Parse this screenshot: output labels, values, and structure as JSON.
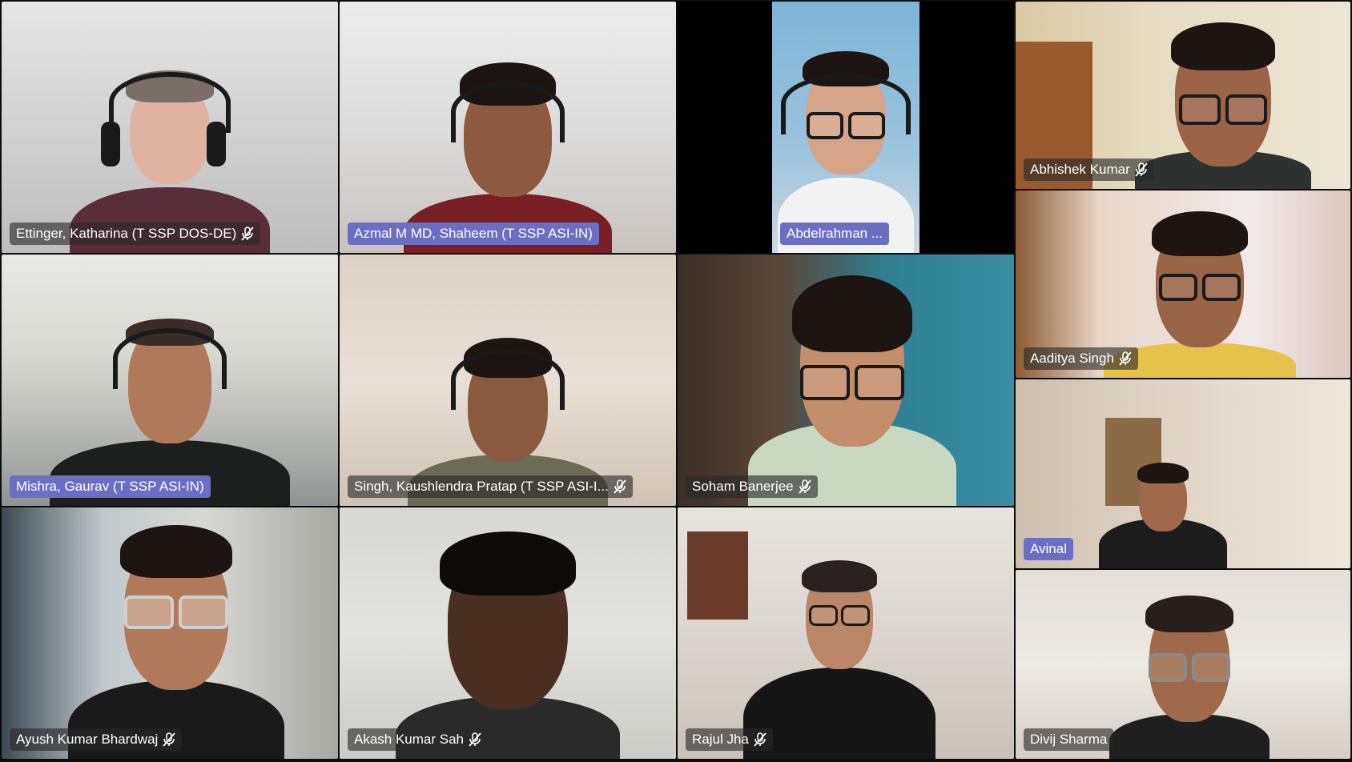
{
  "participants": [
    {
      "name": "Ettinger, Katharina (T SSP DOS-DE)",
      "muted": true,
      "speaking": false
    },
    {
      "name": "Azmal M MD, Shaheem (T SSP ASI-IN)",
      "muted": false,
      "speaking": true
    },
    {
      "name": "Abdelrahman ...",
      "muted": false,
      "speaking": true
    },
    {
      "name": "Abhishek Kumar",
      "muted": true,
      "speaking": false
    },
    {
      "name": "Aaditya Singh",
      "muted": true,
      "speaking": false
    },
    {
      "name": "Mishra, Gaurav (T SSP ASI-IN)",
      "muted": false,
      "speaking": true
    },
    {
      "name": "Singh, Kaushlendra Pratap (T SSP ASI-I...",
      "muted": true,
      "speaking": false
    },
    {
      "name": "Soham Banerjee",
      "muted": true,
      "speaking": false
    },
    {
      "name": "Avinal",
      "muted": false,
      "speaking": true
    },
    {
      "name": "Ayush Kumar Bhardwaj",
      "muted": true,
      "speaking": false
    },
    {
      "name": "Akash Kumar Sah",
      "muted": true,
      "speaking": false
    },
    {
      "name": "Rajul Jha",
      "muted": true,
      "speaking": false
    },
    {
      "name": "Divij Sharma",
      "muted": false,
      "speaking": false
    }
  ],
  "colors": {
    "speaking_tag": "#6b6fc4",
    "name_tag": "#282828"
  },
  "icons": {
    "muted": "mic-off-icon"
  }
}
